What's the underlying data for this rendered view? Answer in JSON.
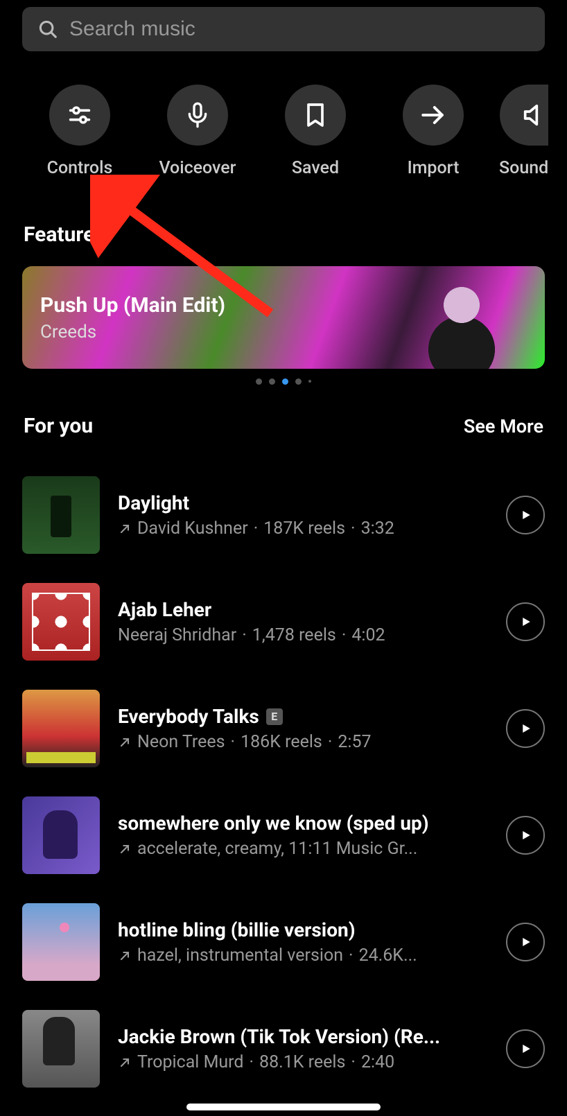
{
  "search": {
    "placeholder": "Search music"
  },
  "tools": [
    {
      "key": "controls",
      "label": "Controls"
    },
    {
      "key": "voiceover",
      "label": "Voiceover"
    },
    {
      "key": "saved",
      "label": "Saved"
    },
    {
      "key": "import",
      "label": "Import"
    },
    {
      "key": "sound",
      "label": "Sound"
    }
  ],
  "featured": {
    "heading": "Featured",
    "title": "Push Up (Main Edit)",
    "artist": "Creeds",
    "active_dot": 2,
    "dot_count": 5
  },
  "for_you": {
    "heading": "For you",
    "see_more": "See More",
    "tracks": [
      {
        "title": "Daylight",
        "artist": "David Kushner",
        "reels": "187K reels",
        "duration": "3:32",
        "trending": true,
        "explicit": false
      },
      {
        "title": "Ajab Leher",
        "artist": "Neeraj Shridhar",
        "reels": "1,478 reels",
        "duration": "4:02",
        "trending": false,
        "explicit": false
      },
      {
        "title": "Everybody Talks",
        "artist": "Neon Trees",
        "reels": "186K reels",
        "duration": "2:57",
        "trending": true,
        "explicit": true
      },
      {
        "title": "somewhere only we know (sped up)",
        "artist": "accelerate, creamy, 11:11 Music Gr...",
        "reels": "",
        "duration": "",
        "trending": true,
        "explicit": false
      },
      {
        "title": "hotline bling (billie version)",
        "artist": "hazel, instrumental version",
        "reels": "24.6K...",
        "duration": "",
        "trending": true,
        "explicit": false
      },
      {
        "title": "Jackie Brown (Tik Tok Version) (Re...",
        "artist": "Tropical Murd",
        "reels": "88.1K reels",
        "duration": "2:40",
        "trending": true,
        "explicit": false
      }
    ]
  },
  "explicit_badge": "E",
  "annotation": {
    "points_to": "controls"
  }
}
